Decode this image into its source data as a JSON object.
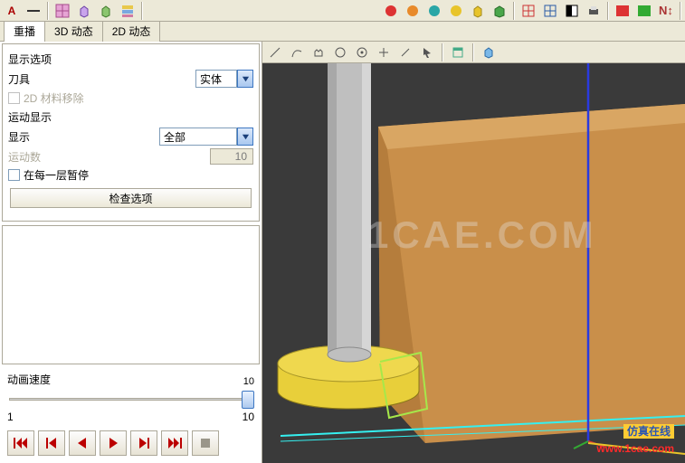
{
  "tabs": {
    "replay": "重播",
    "dyn3d": "3D 动态",
    "dyn2d": "2D 动态"
  },
  "panel": {
    "displayOptionsTitle": "显示选项",
    "toolLabel": "刀具",
    "toolValue": "实体",
    "material2d": "2D 材料移除",
    "motionDisplayTitle": "运动显示",
    "displayLabel": "显示",
    "displayValue": "全部",
    "motionCountLabel": "运动数",
    "motionCountValue": "10",
    "pauseEachLayer": "在每一层暂停",
    "checkOptions": "检查选项",
    "animSpeedTitle": "动画速度",
    "sliderMin": "1",
    "sliderMax": "10"
  },
  "watermark": "1CAE.COM",
  "promo": {
    "line1": "仿真在线",
    "line2": "www.1cae.com"
  },
  "topToolbarA": "A"
}
